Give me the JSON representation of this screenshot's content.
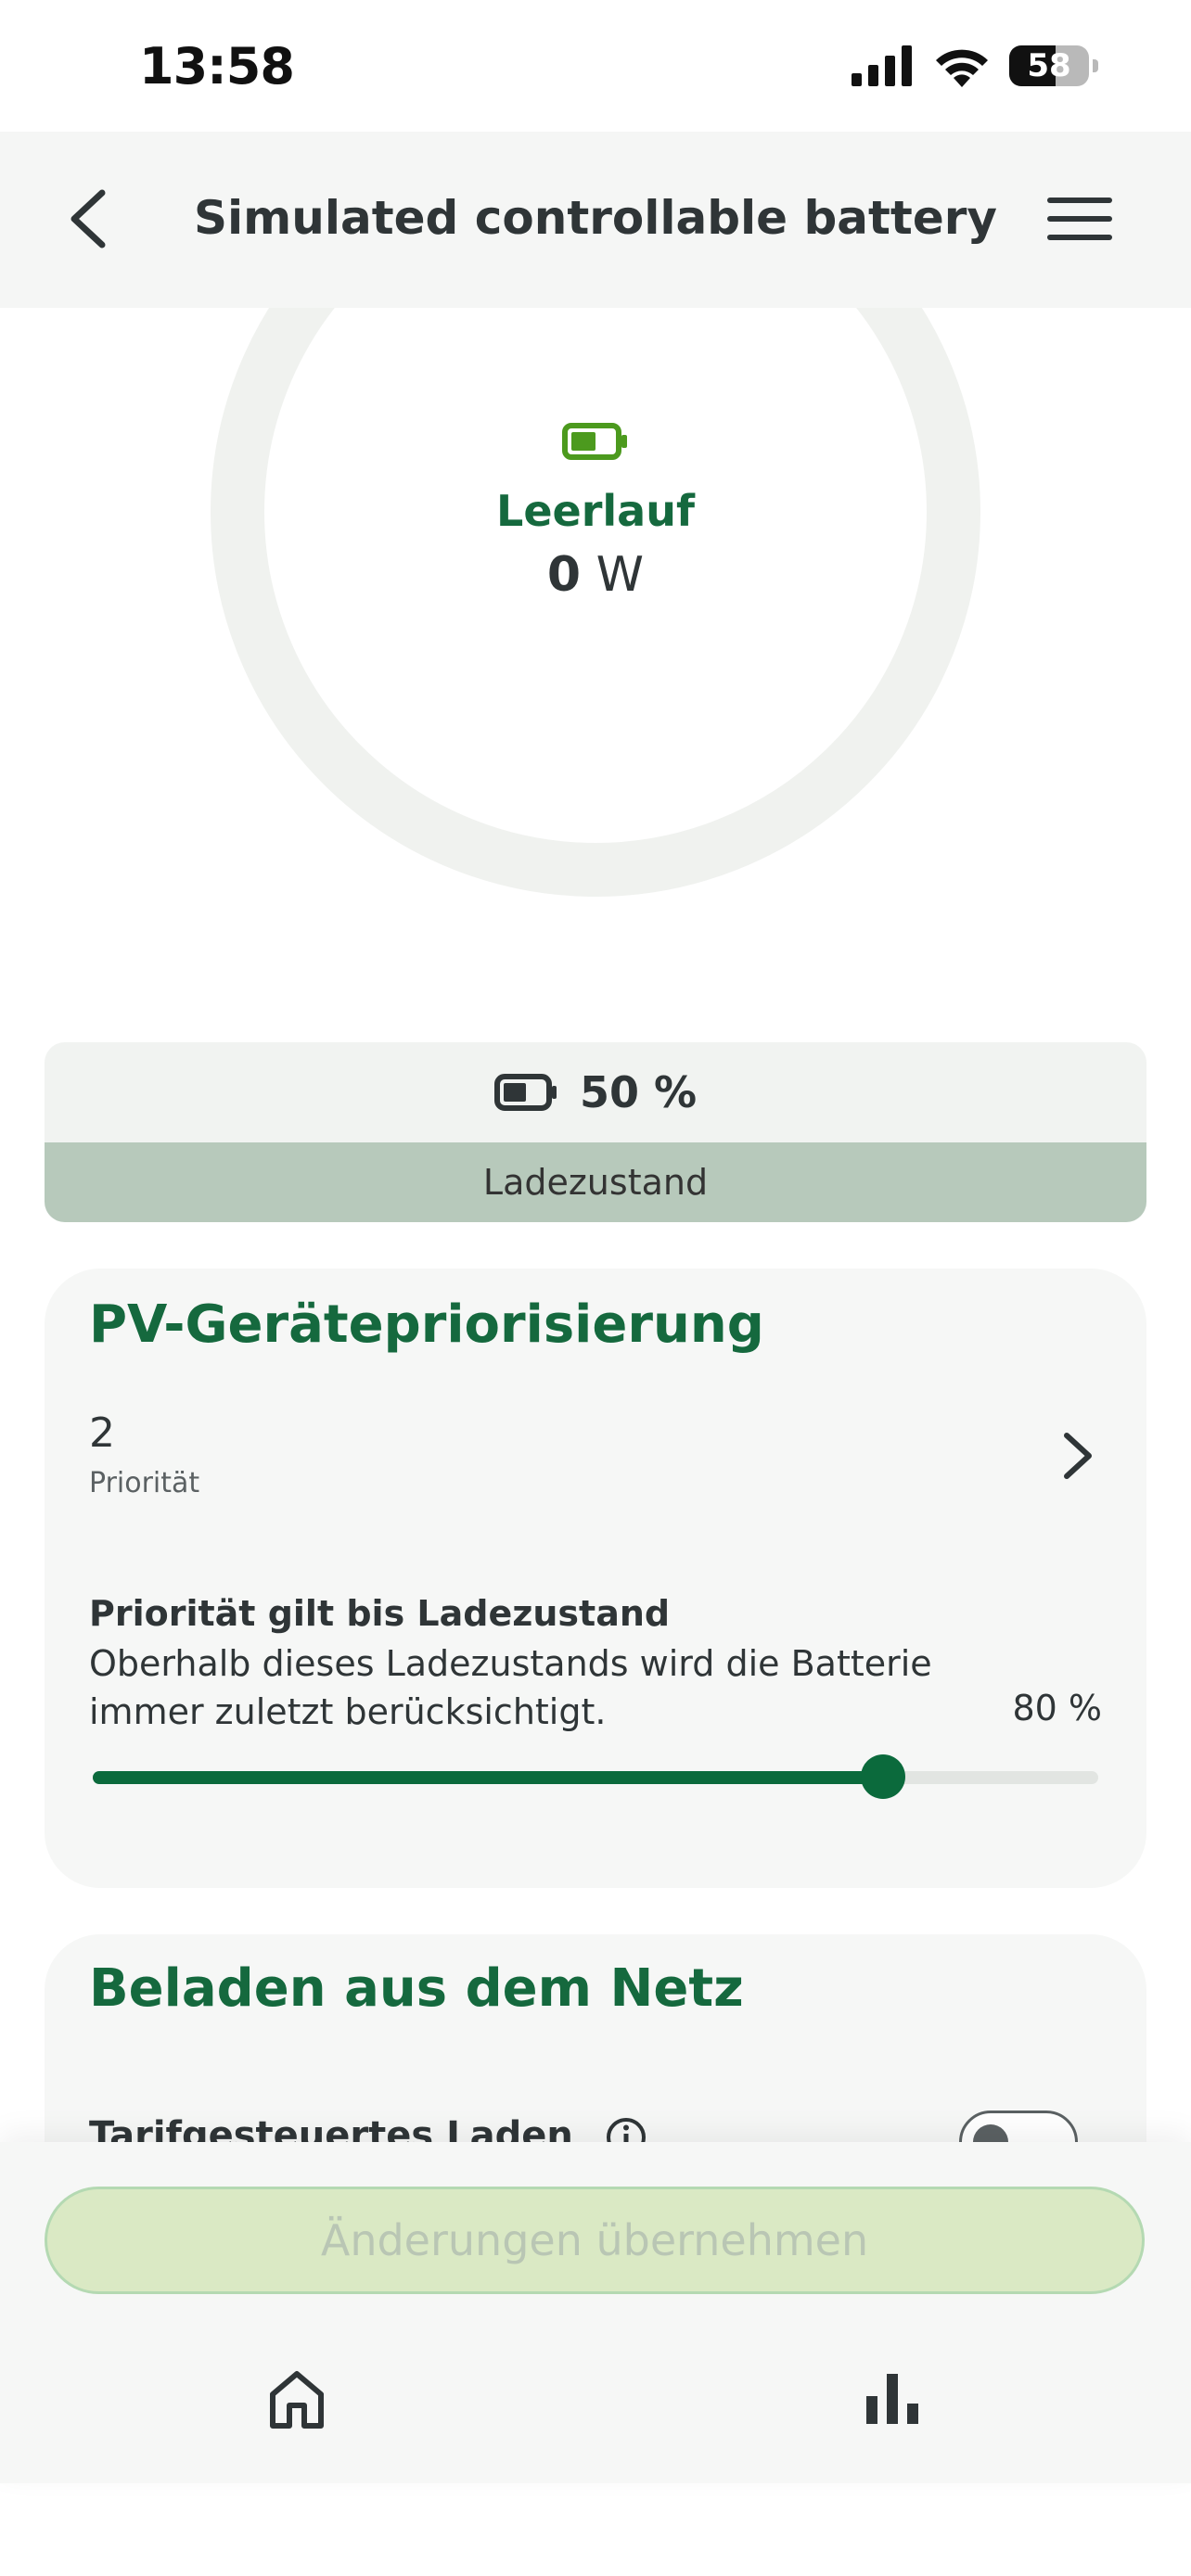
{
  "status_bar": {
    "time": "13:58",
    "battery_level": "58"
  },
  "header": {
    "title": "Simulated controllable battery"
  },
  "overview": {
    "state_label": "Leerlauf",
    "power_value": "0",
    "power_unit": "W"
  },
  "state_of_charge": {
    "value": "50 %",
    "label": "Ladezustand"
  },
  "pv_priority": {
    "title": "PV-Gerätepriorisierung",
    "priority_value": "2",
    "priority_label": "Priorität",
    "soc_limit_title": "Priorität gilt bis Ladezustand",
    "soc_limit_description": "Oberhalb dieses Ladezustands wird die Batterie immer zuletzt berücksichtigt.",
    "soc_limit_value": "80 %",
    "soc_limit_percent": 80
  },
  "grid_charging": {
    "title": "Beladen aus dem Netz",
    "tariff_toggle_label": "Tarifgesteuertes Laden",
    "tariff_toggle_on": false
  },
  "actions": {
    "apply_label": "Änderungen übernehmen"
  },
  "colors": {
    "accent": "#15693e",
    "slider": "#0b6a3c",
    "battery_icon": "#4c9a1e"
  },
  "nav": {
    "items": [
      "home-icon",
      "stats-icon"
    ]
  }
}
